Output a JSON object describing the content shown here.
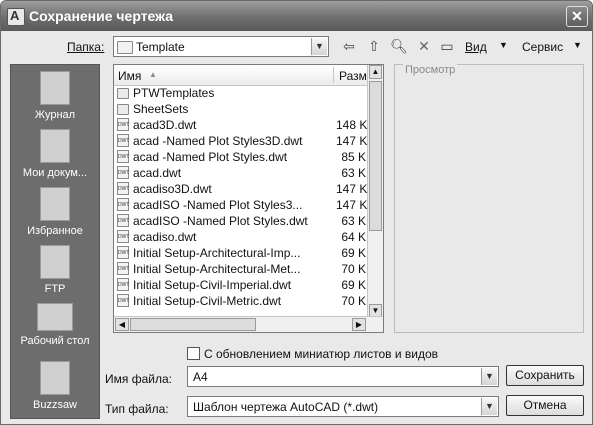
{
  "window": {
    "title": "Сохранение чертежа",
    "close_label": "✕"
  },
  "folder": {
    "label": "Папка:",
    "value": "Template"
  },
  "toolbar": {
    "view_label": "Вид",
    "tools_label": "Сервис"
  },
  "places": [
    {
      "label": "Журнал",
      "icon": "history-icon"
    },
    {
      "label": "Мои докум...",
      "icon": "my-documents-icon"
    },
    {
      "label": "Избранное",
      "icon": "favorites-icon"
    },
    {
      "label": "FTP",
      "icon": "ftp-icon"
    },
    {
      "label": "Рабочий стол",
      "icon": "desktop-icon"
    },
    {
      "label": "Buzzsaw",
      "icon": "buzzsaw-icon"
    }
  ],
  "list": {
    "col_name": "Имя",
    "col_size": "Разме",
    "rows": [
      {
        "name": "PTWTemplates",
        "size": "",
        "kind": "folder"
      },
      {
        "name": "SheetSets",
        "size": "",
        "kind": "folder"
      },
      {
        "name": "acad3D.dwt",
        "size": "148 K",
        "kind": "dwt"
      },
      {
        "name": "acad -Named Plot Styles3D.dwt",
        "size": "147 K",
        "kind": "dwt"
      },
      {
        "name": "acad -Named Plot Styles.dwt",
        "size": "85 K",
        "kind": "dwt"
      },
      {
        "name": "acad.dwt",
        "size": "63 K",
        "kind": "dwt"
      },
      {
        "name": "acadiso3D.dwt",
        "size": "147 K",
        "kind": "dwt"
      },
      {
        "name": "acadISO -Named Plot Styles3...",
        "size": "147 K",
        "kind": "dwt"
      },
      {
        "name": "acadISO -Named Plot Styles.dwt",
        "size": "63 K",
        "kind": "dwt"
      },
      {
        "name": "acadiso.dwt",
        "size": "64 K",
        "kind": "dwt"
      },
      {
        "name": "Initial Setup-Architectural-Imp...",
        "size": "69 K",
        "kind": "dwt"
      },
      {
        "name": "Initial Setup-Architectural-Met...",
        "size": "70 K",
        "kind": "dwt"
      },
      {
        "name": "Initial Setup-Civil-Imperial.dwt",
        "size": "69 K",
        "kind": "dwt"
      },
      {
        "name": "Initial Setup-Civil-Metric.dwt",
        "size": "70 K",
        "kind": "dwt"
      }
    ]
  },
  "preview": {
    "label": "Просмотр"
  },
  "thumbnail_option": {
    "label": "С обновлением миниатюр листов и видов"
  },
  "filename": {
    "label": "Имя файла:",
    "value": "A4"
  },
  "filetype": {
    "label": "Тип файла:",
    "value": "Шаблон чертежа AutoCAD (*.dwt)"
  },
  "buttons": {
    "save": "Сохранить",
    "cancel": "Отмена"
  }
}
